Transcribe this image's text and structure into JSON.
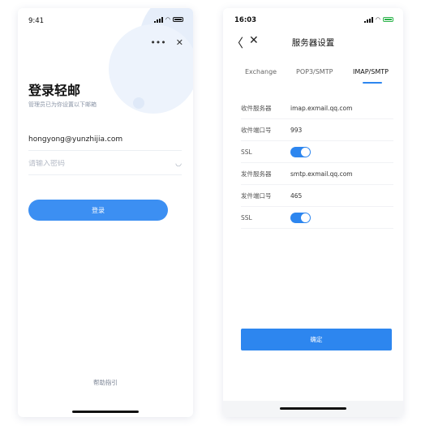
{
  "login": {
    "status_time": "9:41",
    "more_label": "•••",
    "close_label": "✕",
    "title": "登录轻邮",
    "subtitle": "管理员已为你设置以下邮箱",
    "email_value": "hongyong@yunzhijia.com",
    "password_placeholder": "请输入密码",
    "eye_icon": "closed-eye-icon",
    "login_button": "登录",
    "help_link": "帮助指引"
  },
  "server": {
    "status_time": "16:03",
    "back_label": "〈",
    "close_label": "✕",
    "title": "服务器设置",
    "tabs": [
      {
        "label": "Exchange",
        "active": false
      },
      {
        "label": "POP3/SMTP",
        "active": false
      },
      {
        "label": "IMAP/SMTP",
        "active": true
      }
    ],
    "rows": [
      {
        "label": "收件服务器",
        "value": "imap.exmail.qq.com"
      },
      {
        "label": "收件端口号",
        "value": "993"
      },
      {
        "label": "SSL",
        "toggle": true
      },
      {
        "label": "发件服务器",
        "value": "smtp.exmail.qq.com"
      },
      {
        "label": "发件端口号",
        "value": "465"
      },
      {
        "label": "SSL",
        "toggle": true
      }
    ],
    "confirm_button": "确定"
  },
  "colors": {
    "accent_login": "#3c8ff2",
    "accent_settings": "#2d86ef",
    "battery_charging": "#2bb34a"
  }
}
